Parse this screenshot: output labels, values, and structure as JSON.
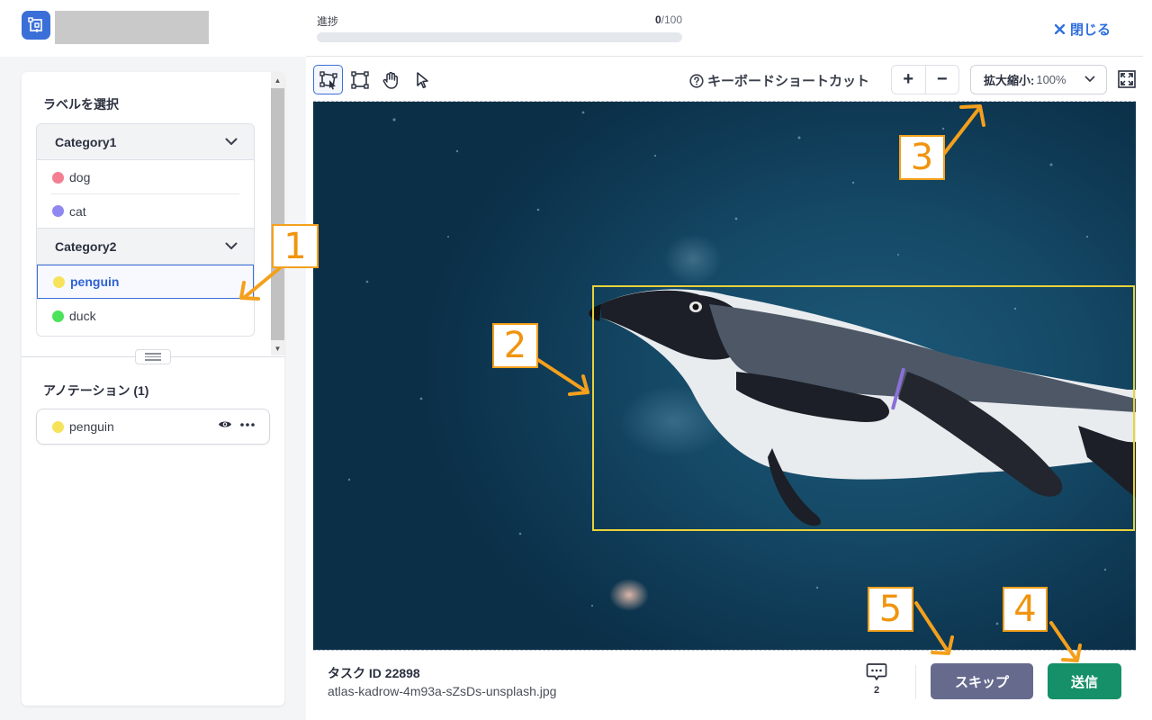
{
  "header": {
    "progress_label": "進捗",
    "progress_done": "0",
    "progress_total": "/100",
    "progress_fraction": 0.0,
    "close_label": "閉じる",
    "close_icon": "close-x-icon",
    "accent_color": "#2f6fde"
  },
  "sidebar": {
    "label_panel_title": "ラベルを選択",
    "categories": [
      {
        "name": "Category1",
        "labels": [
          {
            "name": "dog",
            "color": "#f47f92"
          },
          {
            "name": "cat",
            "color": "#8f88f0"
          }
        ]
      },
      {
        "name": "Category2",
        "labels": [
          {
            "name": "penguin",
            "color": "#f6e35a",
            "selected": true
          },
          {
            "name": "duck",
            "color": "#4ce25c"
          }
        ]
      }
    ],
    "annotation_panel_title": "アノテーション (1)",
    "annotations": [
      {
        "label": "penguin",
        "color": "#f6e35a"
      }
    ]
  },
  "toolbar": {
    "tools": [
      "polygon-tool-icon",
      "bounding-box-tool-icon",
      "hand-pan-tool-icon",
      "select-pointer-tool-icon"
    ],
    "active_tool": "polygon-tool-icon",
    "shortcut_label": "キーボードショートカット",
    "zoom_in_label": "+",
    "zoom_out_label": "−",
    "zoom_label": "拡大縮小:",
    "zoom_value": "100%"
  },
  "canvas": {
    "bbox_label": "penguin",
    "bbox_color": "#e9d33a"
  },
  "callouts": [
    "1",
    "2",
    "3",
    "4",
    "5"
  ],
  "footer": {
    "task_id": "タスク ID 22898",
    "filename": "atlas-kadrow-4m93a-sZsDs-unsplash.jpg",
    "comment_count": "2",
    "skip_label": "スキップ",
    "submit_label": "送信",
    "skip_color": "#666b8e",
    "submit_color": "#169068"
  }
}
